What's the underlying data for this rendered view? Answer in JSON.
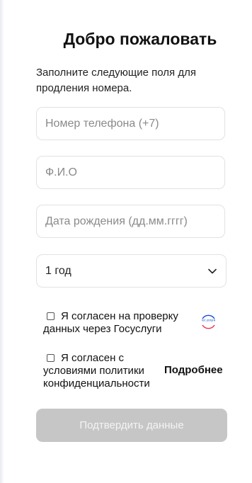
{
  "form": {
    "title": "Добро пожаловать",
    "subtitle": "Заполните следующие поля для продления номера.",
    "phone_placeholder": "Номер телефона (+7)",
    "name_placeholder": "Ф.И.О",
    "dob_placeholder": "Дата рождения (дд.мм.гггг)",
    "period": {
      "selected": "1 год"
    },
    "consent_gosuslugi": "Я согласен на проверку данных через Госуслуги",
    "gosuslugi_logo_text": "гос услуги",
    "consent_policy": "Я согласен с условиями политики конфиденциальности",
    "more_link": "Подробнее",
    "submit_label": "Подтвердить данные"
  },
  "colors": {
    "submit_bg": "#c6c6c6",
    "field_border": "#e2e2e2",
    "gos_blue": "#0d4cd3",
    "gos_red": "#ee2f53"
  }
}
